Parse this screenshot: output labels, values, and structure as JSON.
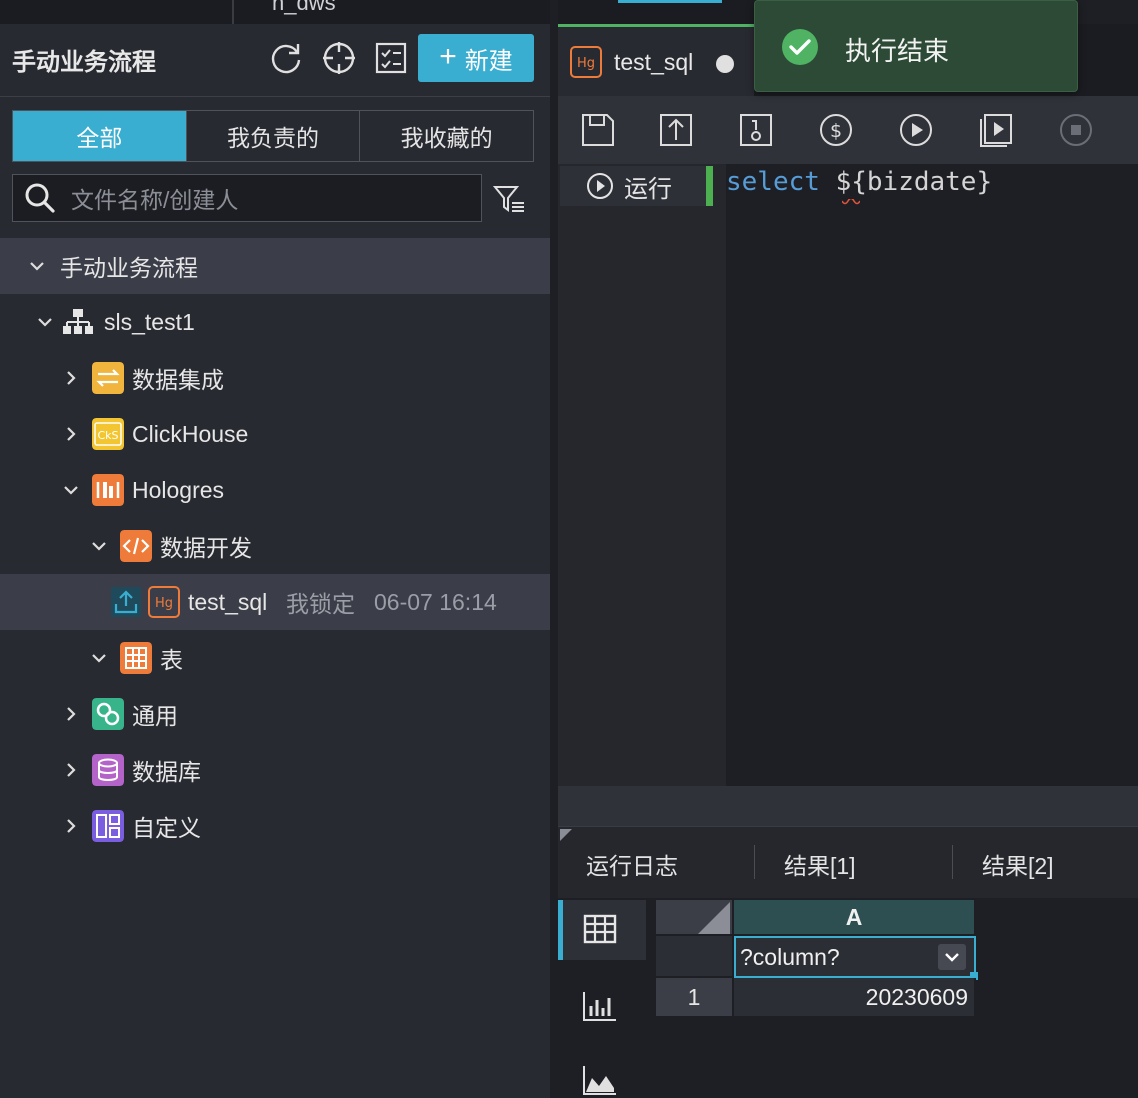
{
  "top_tab": {
    "partial_title": "n_dws"
  },
  "panel": {
    "title": "手动业务流程",
    "new_button": "新建",
    "segments": [
      "全部",
      "我负责的",
      "我收藏的"
    ],
    "search_placeholder": "文件名称/创建人"
  },
  "tree": {
    "root": "手动业务流程",
    "workflow": "sls_test1",
    "items": {
      "data_integration": "数据集成",
      "clickhouse": "ClickHouse",
      "hologres": "Hologres",
      "data_dev": "数据开发",
      "test_sql": {
        "name": "test_sql",
        "lock": "我锁定",
        "time": "06-07 16:14"
      },
      "table": "表",
      "general": "通用",
      "database": "数据库",
      "custom": "自定义"
    }
  },
  "editor": {
    "tab_title": "test_sql",
    "tab_badge": "Hg",
    "run_label": "运行",
    "code_keyword": "select",
    "code_rest": " ${bizdate}"
  },
  "results": {
    "tabs": [
      "运行日志",
      "结果[1]",
      "结果[2]"
    ],
    "column_letter": "A",
    "column_name": "?column?",
    "row_index": "1",
    "value": "20230609"
  },
  "toast": {
    "message": "执行结束"
  },
  "colors": {
    "accent": "#3aaed1",
    "success": "#4fb363",
    "hologres": "#ef7b3a"
  }
}
